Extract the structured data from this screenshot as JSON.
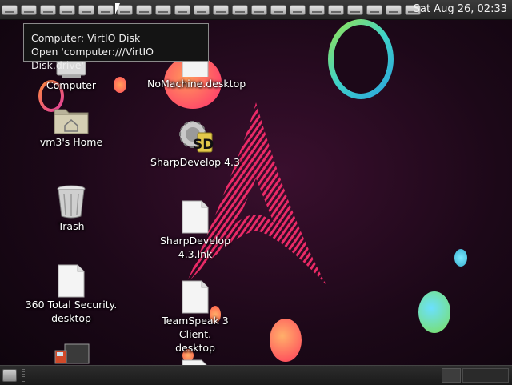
{
  "top_panel": {
    "clock": "Sat Aug 26, 02:33",
    "drive_count": 22
  },
  "tooltip": {
    "line1": "Computer: VirtIO Disk",
    "line2": "Open 'computer:///VirtIO Disk.drive'"
  },
  "desktop": {
    "computer": "Computer",
    "home": "vm3's Home",
    "trash": "Trash",
    "security_line1": "360 Total Security.",
    "security_line2": "desktop",
    "nomachine": "NoMachine.desktop",
    "sharpdevelop": "SharpDevelop 4.3",
    "sharpdevelop_lnk": "SharpDevelop 4.3.lnk",
    "teamspeak_line1": "TeamSpeak 3 Client.",
    "teamspeak_line2": "desktop",
    "sd_badge": "SD"
  },
  "colors": {
    "background": "#1c0818",
    "arch_logo": "#ff2d6e",
    "panel": "#2d2d2d"
  }
}
